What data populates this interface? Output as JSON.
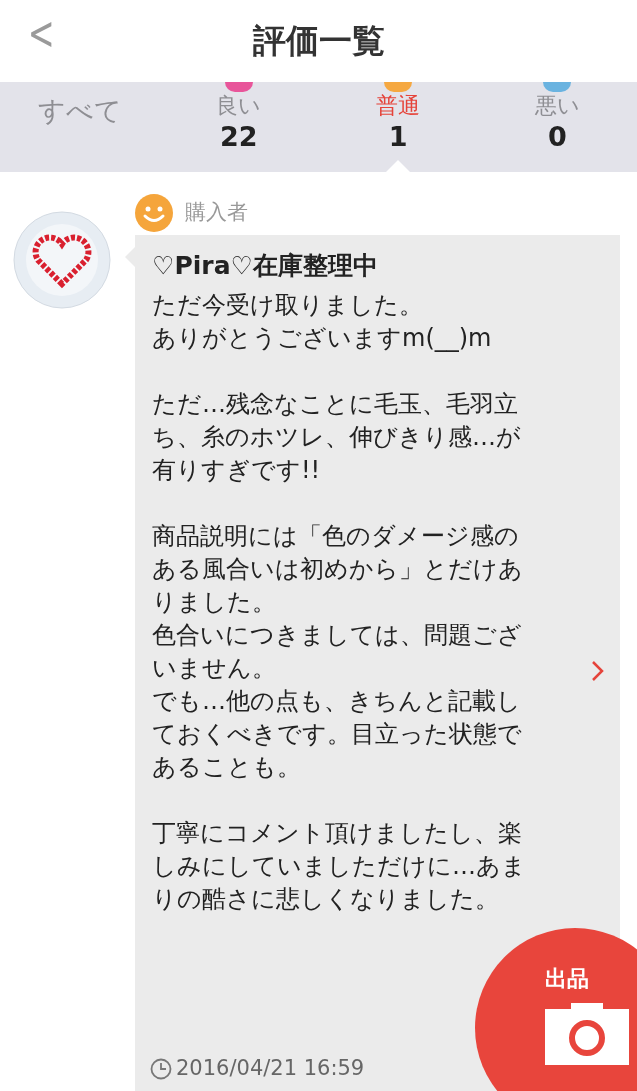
{
  "header": {
    "back": "<",
    "title": "評価一覧"
  },
  "tabs": [
    {
      "kind": "all",
      "label": "すべて",
      "selected": false
    },
    {
      "kind": "rating",
      "label": "良い",
      "count": "22",
      "color": "#e8559a",
      "selected": false
    },
    {
      "kind": "rating",
      "label": "普通",
      "count": "1",
      "color": "#f5a841",
      "selected": true
    },
    {
      "kind": "rating",
      "label": "悪い",
      "count": "0",
      "color": "#6ab3e0",
      "selected": false
    }
  ],
  "review": {
    "role": "購入者",
    "color": "#f5a53b",
    "author": "♡Pira♡在庫整理中",
    "paragraphs": [
      [
        "ただ今受け取りました。",
        "ありがとうございますm(__)m"
      ],
      [
        "ただ…残念なことに毛玉、毛羽立",
        "ち、糸のホツレ、伸びきり感…が",
        "有りすぎです!!"
      ],
      [
        "商品説明には「色のダメージ感の",
        "ある風合いは初めから」とだけあ",
        "りました。",
        "色合いにつきましては、問題ござ",
        "いません。",
        "でも…他の点も、きちんと記載し",
        "ておくべきです。目立った状態で",
        "あることも。"
      ],
      [
        "丁寧にコメント頂けましたし、楽",
        "しみにしていましただけに…あま",
        "りの酷さに悲しくなりました。"
      ]
    ],
    "time": "2016/04/21 16:59"
  },
  "fab": {
    "label": "出品"
  }
}
